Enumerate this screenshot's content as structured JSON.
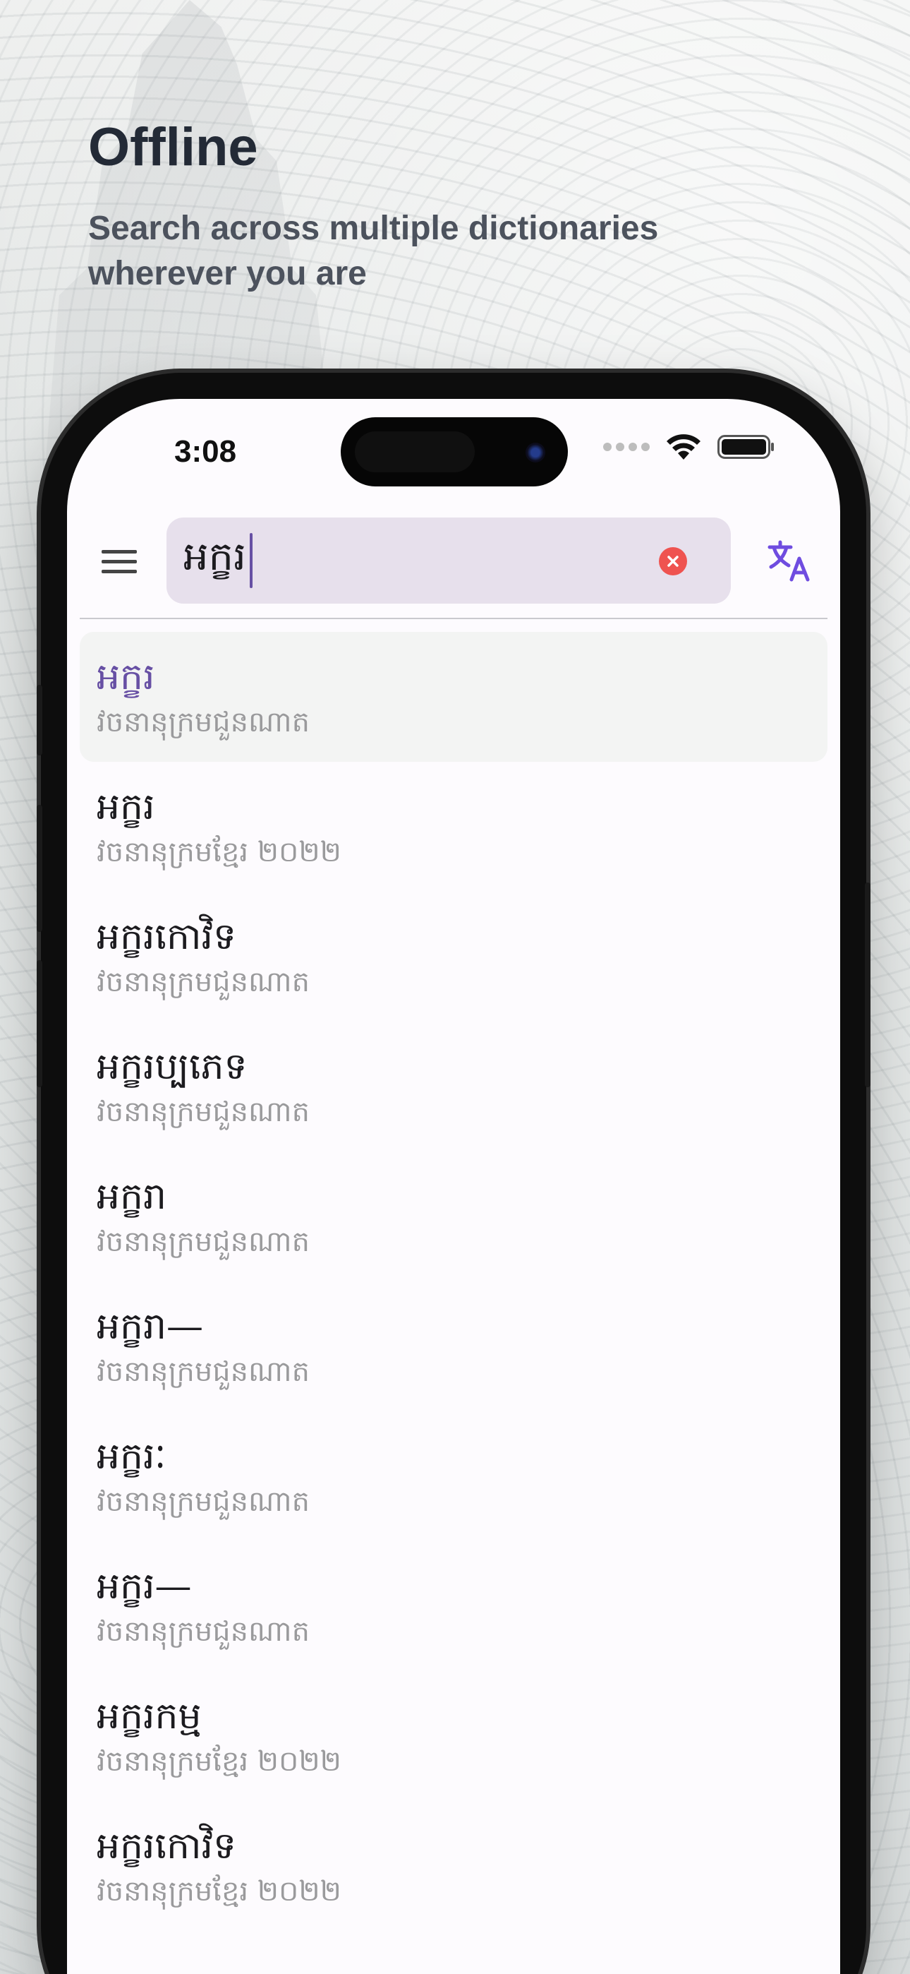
{
  "promo": {
    "title": "Offline",
    "subtitle": "Search across multiple dictionaries wherever you are"
  },
  "status_bar": {
    "time": "3:08"
  },
  "search": {
    "value": "អក្ខរ",
    "placeholder": ""
  },
  "icons": {
    "menu": "menu-icon",
    "clear": "clear-icon",
    "translate": "translate-icon",
    "wifi": "wifi-icon",
    "battery": "battery-icon"
  },
  "colors": {
    "accent": "#6750a4",
    "search_bg": "#e7e0ec",
    "clear": "#ef5350",
    "translate_icon": "#6f4ce0"
  },
  "results": [
    {
      "word": "អក្ខរ",
      "source": "វចនានុក្រមជួនណាត"
    },
    {
      "word": "អក្ខរ",
      "source": "វចនានុក្រមខ្មែរ ២០២២"
    },
    {
      "word": "អក្ខរកោវិទ",
      "source": "វចនានុក្រមជួនណាត"
    },
    {
      "word": "អក្ខរប្បភេទ",
      "source": "វចនានុក្រមជួនណាត"
    },
    {
      "word": "អក្ខរា",
      "source": "វចនានុក្រមជួនណាត"
    },
    {
      "word": "អក្ខរា—",
      "source": "វចនានុក្រមជួនណាត"
    },
    {
      "word": "អក្ខរៈ",
      "source": "វចនានុក្រមជួនណាត"
    },
    {
      "word": "អក្ខរ—",
      "source": "វចនានុក្រមជួនណាត"
    },
    {
      "word": "អក្ខរកម្ម",
      "source": "វចនានុក្រមខ្មែរ ២០២២"
    },
    {
      "word": "អក្ខរកោវិទ",
      "source": "វចនានុក្រមខ្មែរ ២០២២"
    }
  ]
}
